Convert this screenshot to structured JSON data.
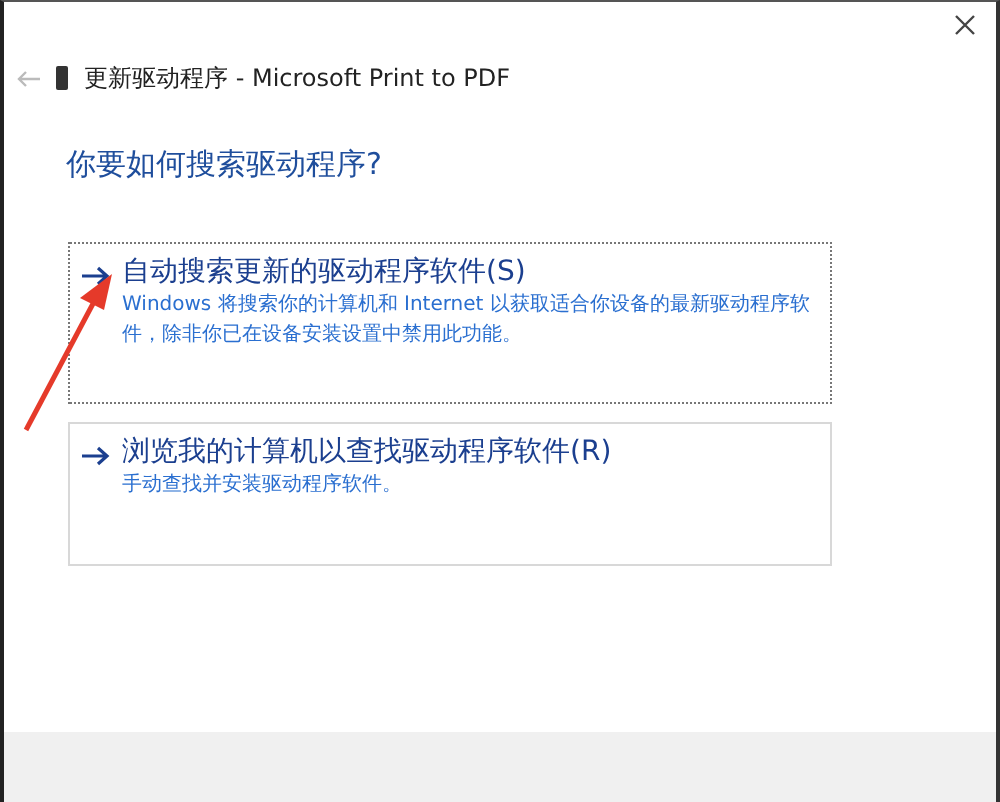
{
  "window": {
    "title": "更新驱动程序 - Microsoft Print to PDF"
  },
  "heading": "你要如何搜索驱动程序?",
  "options": [
    {
      "title": "自动搜索更新的驱动程序软件(S)",
      "description": "Windows 将搜索你的计算机和 Internet 以获取适合你设备的最新驱动程序软件，除非你已在设备安装设置中禁用此功能。",
      "focused": true
    },
    {
      "title": "浏览我的计算机以查找驱动程序软件(R)",
      "description": "手动查找并安装驱动程序软件。",
      "focused": false
    }
  ],
  "annotation_arrow": true
}
